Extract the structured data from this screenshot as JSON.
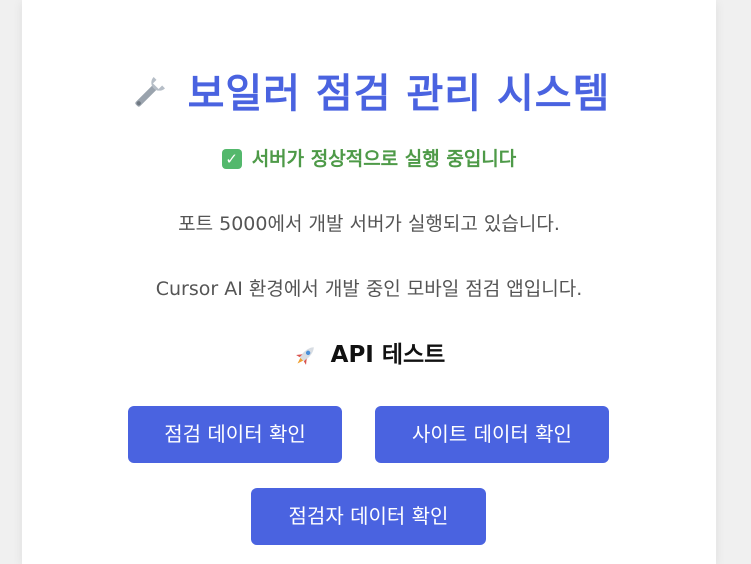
{
  "header": {
    "icon": "wrench-icon",
    "title": "보일러 점검 관리 시스템"
  },
  "status": {
    "icon": "check-icon",
    "text": "서버가 정상적으로 실행 중입니다"
  },
  "descriptions": [
    "포트 5000에서 개발 서버가 실행되고 있습니다.",
    "Cursor AI 환경에서 개발 중인 모바일 점검 앱입니다."
  ],
  "api_section": {
    "icon": "rocket-icon",
    "title": "API 테스트",
    "buttons": [
      "점검 데이터 확인",
      "사이트 데이터 확인",
      "점검자 데이터 확인"
    ]
  },
  "colors": {
    "accent": "#4a63e0",
    "status_green": "#4e9a48",
    "text_gray": "#555555"
  }
}
